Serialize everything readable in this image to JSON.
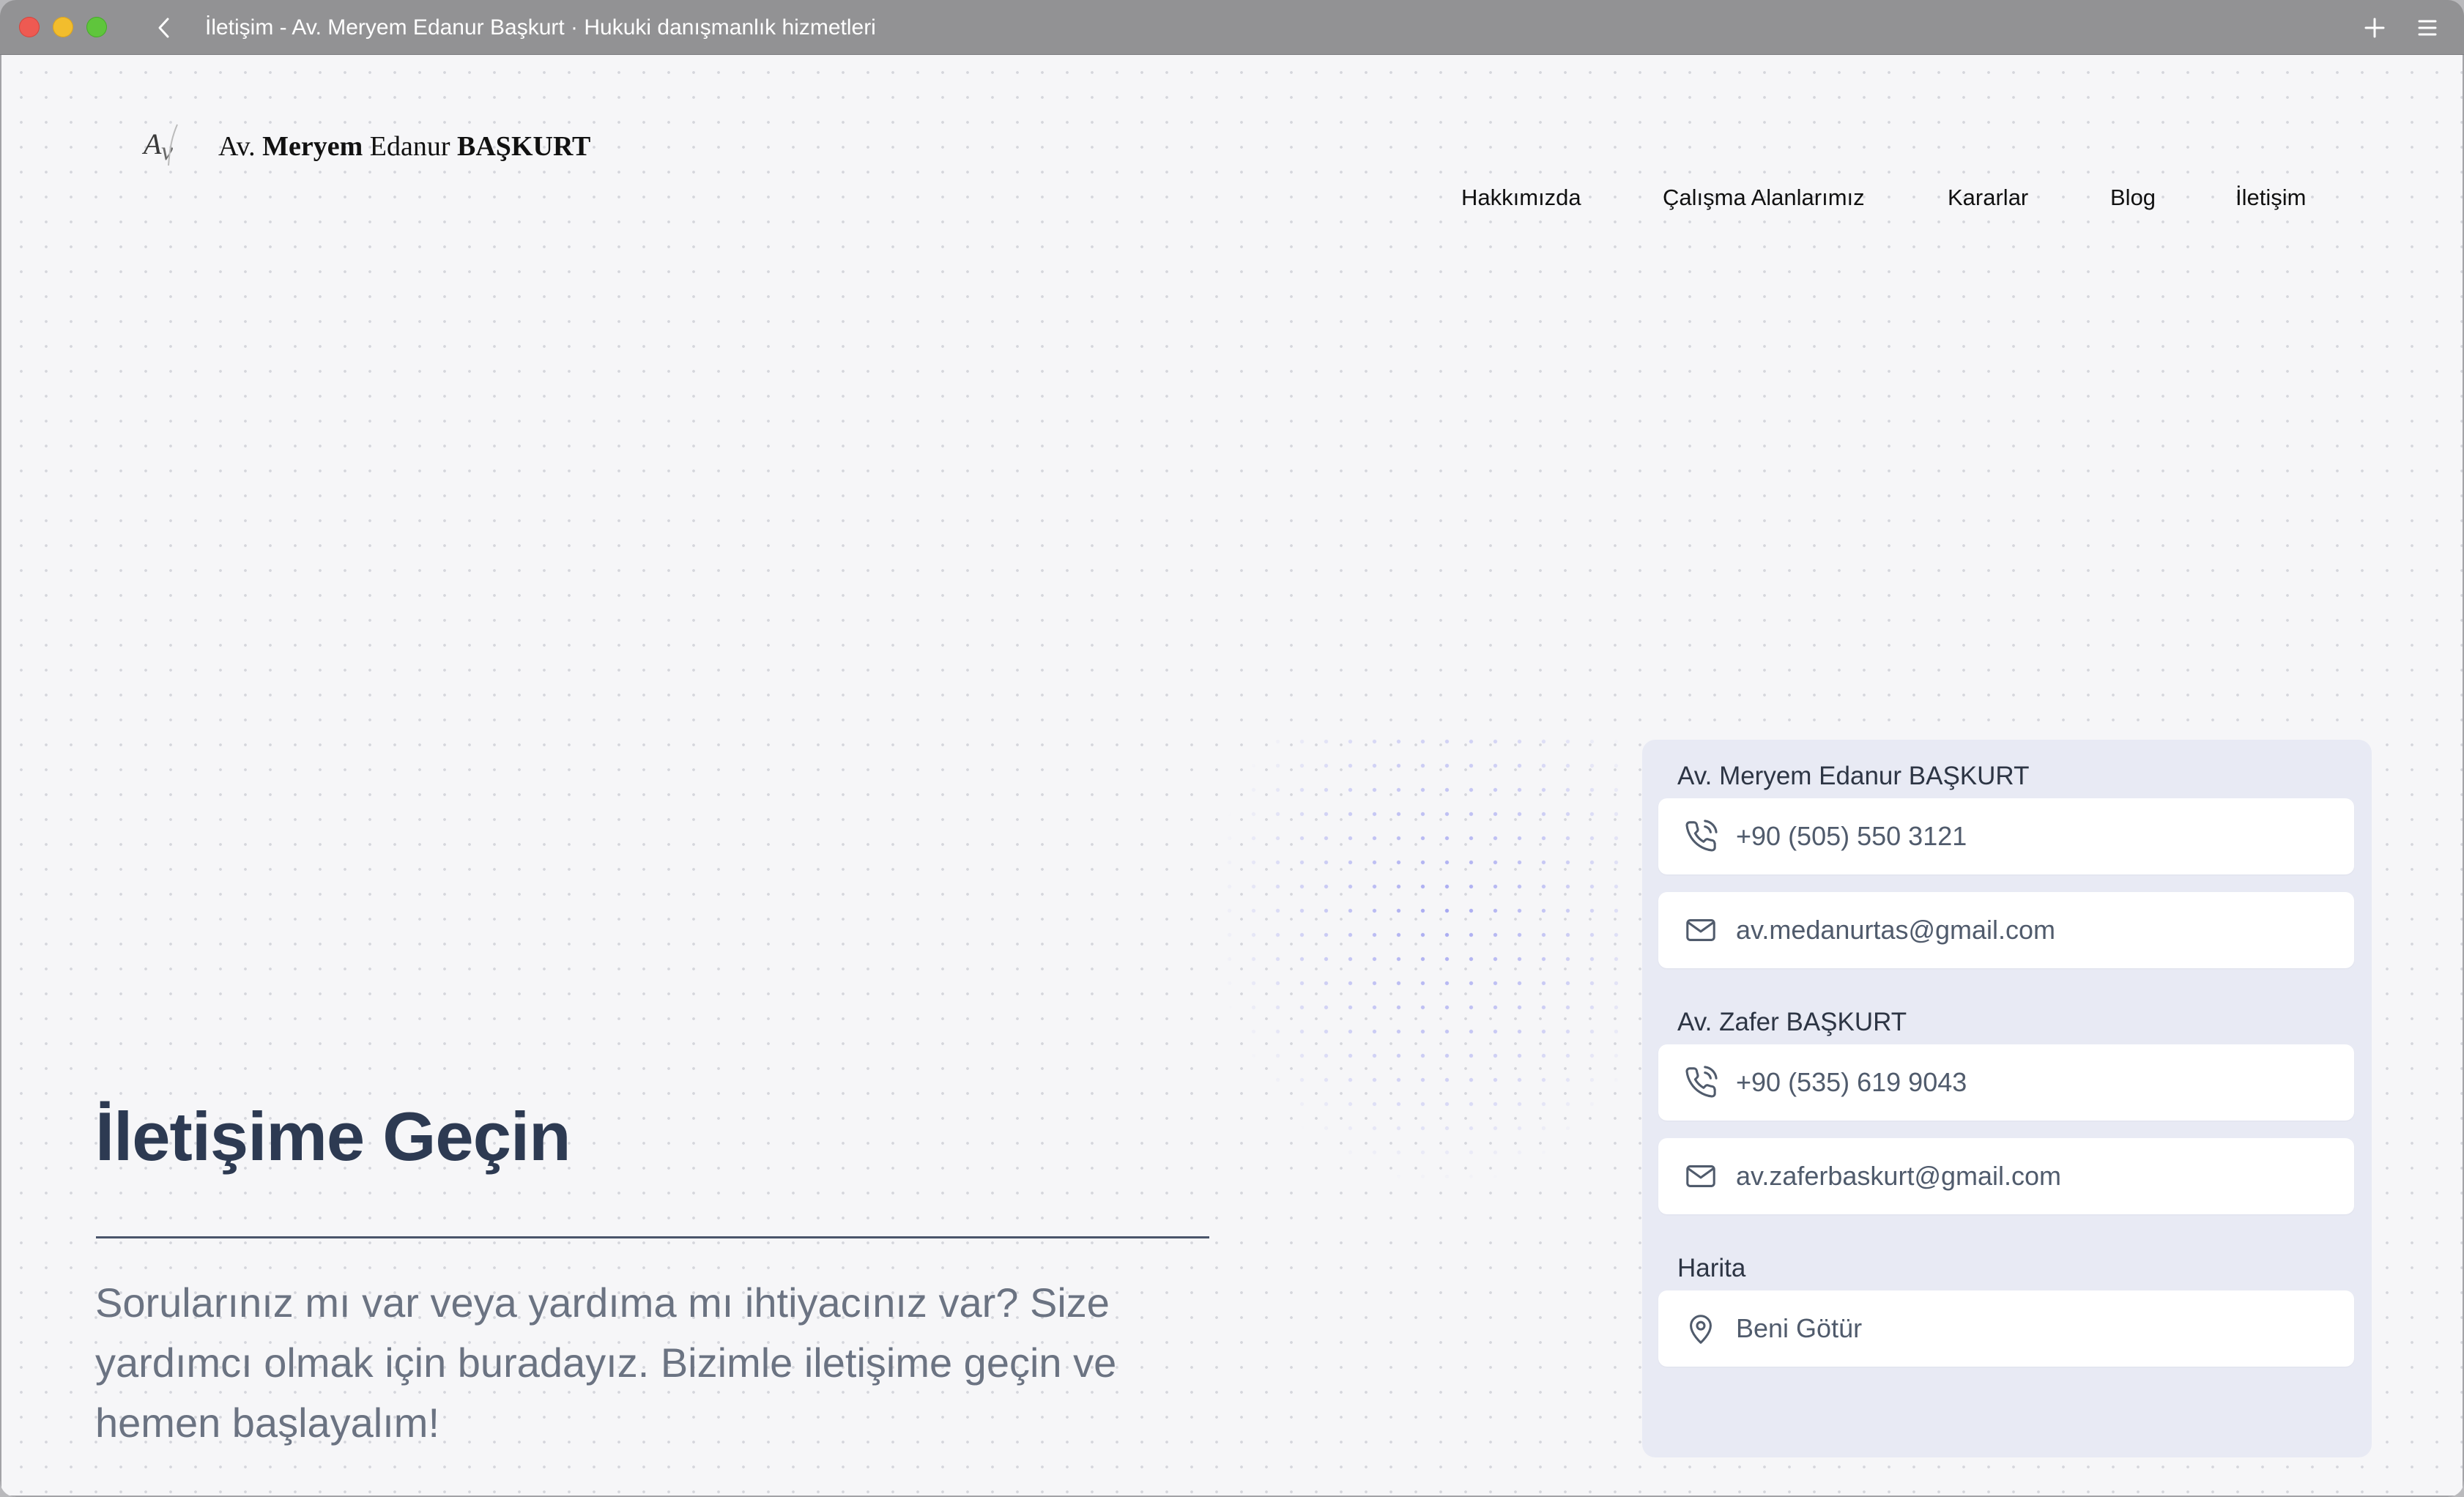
{
  "browser": {
    "title": "İletişim - Av. Meryem Edanur Başkurt · Hukuki danışmanlık hizmetleri"
  },
  "header": {
    "logo_prefix": "Av.",
    "logo_first": "Meryem",
    "logo_middle": "Edanur",
    "logo_last": "BAŞKURT",
    "nav": [
      "Hakkımızda",
      "Çalışma Alanlarımız",
      "Kararlar",
      "Blog",
      "İletişim"
    ]
  },
  "hero": {
    "title": "İletişime Geçin",
    "text": "Sorularınız mı var veya yardıma mı ihtiyacınız var? Size yardımcı olmak için buradayız. Bizimle iletişime geçin ve hemen başlayalım!"
  },
  "contacts": [
    {
      "name": "Av. Meryem Edanur BAŞKURT",
      "phone": "+90 (505) 550 3121",
      "email": "av.medanurtas@gmail.com"
    },
    {
      "name": "Av. Zafer BAŞKURT",
      "phone": "+90 (535) 619 9043",
      "email": "av.zaferbaskurt@gmail.com"
    }
  ],
  "map": {
    "label": "Harita",
    "link": "Beni Götür"
  },
  "icons": {
    "phone": "phone-icon",
    "email": "mail-icon",
    "location": "map-pin-icon"
  }
}
